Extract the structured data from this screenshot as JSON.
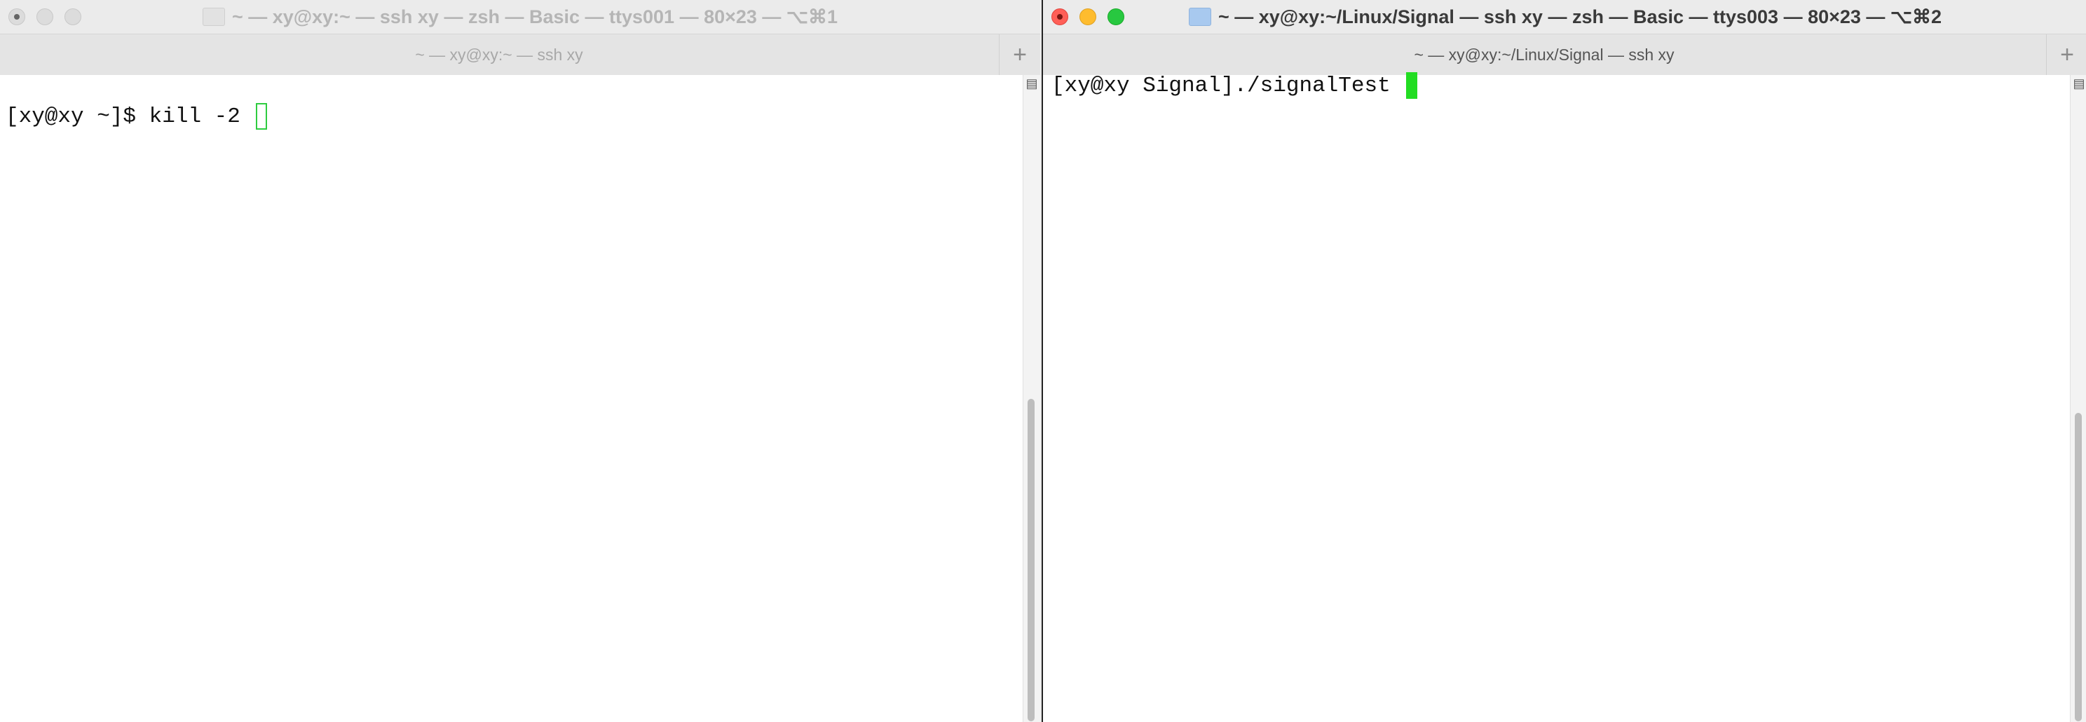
{
  "left_window": {
    "title": "~ — xy@xy:~ — ssh xy — zsh — Basic — ttys001 — 80×23 — ⌥⌘1",
    "tab_label": "~ — xy@xy:~ — ssh xy",
    "prompt": "[xy@xy ~]$ ",
    "command": "kill -2 ",
    "new_tab_symbol": "+",
    "scroll_marker": "▤"
  },
  "right_window": {
    "title": "~ — xy@xy:~/Linux/Signal — ssh xy — zsh — Basic — ttys003 — 80×23 — ⌥⌘2",
    "tab_label": "~ — xy@xy:~/Linux/Signal — ssh xy",
    "prompt": "[xy@xy Signal]",
    "command": "./signalTest ",
    "new_tab_symbol": "+",
    "scroll_marker": "▤"
  },
  "colors": {
    "cursor": "#22dd22",
    "close": "#ff5f57",
    "minimize": "#febc2e",
    "maximize": "#28c840"
  }
}
